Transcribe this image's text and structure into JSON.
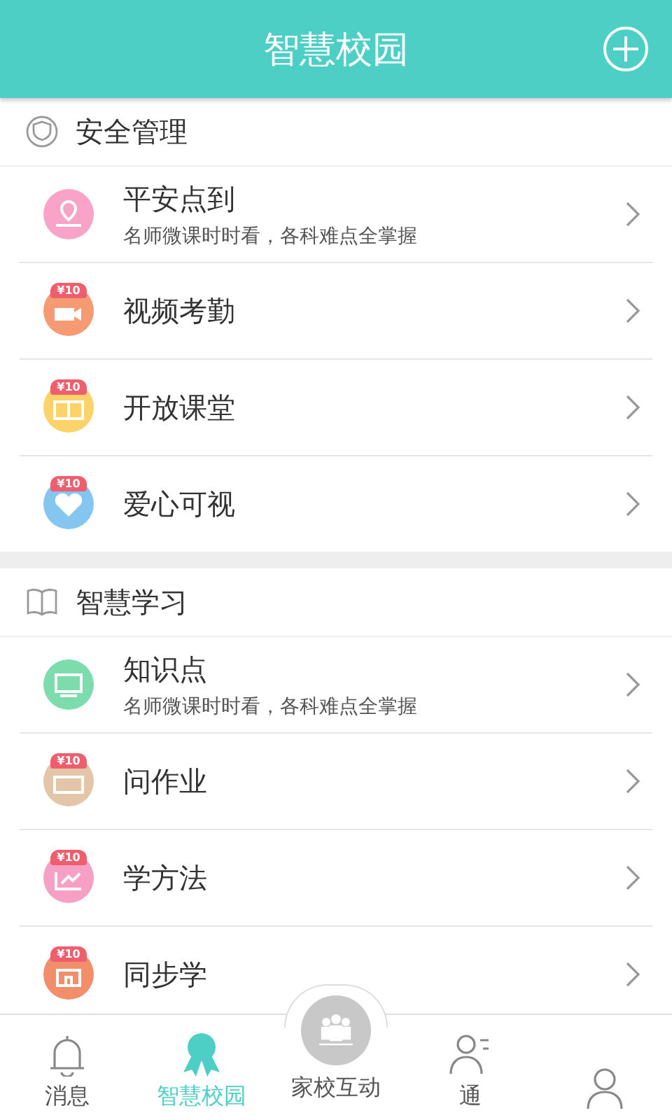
{
  "header": {
    "title": "智慧校园"
  },
  "sections": [
    {
      "title": "安全管理",
      "items": [
        {
          "title": "平安点到",
          "subtitle": "名师微课时时看，各科难点全掌握",
          "color": "#f9a3c9"
        },
        {
          "title": "视频考勤",
          "badge": "¥10",
          "color": "#f59a72"
        },
        {
          "title": "开放课堂",
          "badge": "¥10",
          "color": "#fcd36a"
        },
        {
          "title": "爱心可视",
          "badge": "¥10",
          "color": "#85c6f0"
        }
      ]
    },
    {
      "title": "智慧学习",
      "items": [
        {
          "title": "知识点",
          "subtitle": "名师微课时时看，各科难点全掌握",
          "color": "#7ddcac"
        },
        {
          "title": "问作业",
          "badge": "¥10",
          "color": "#e2c6a7"
        },
        {
          "title": "学方法",
          "badge": "¥10",
          "color": "#f7a0c6"
        },
        {
          "title": "同步学",
          "badge": "¥10",
          "color": "#f28e6a"
        }
      ]
    }
  ],
  "tabs": [
    {
      "label": "消息",
      "selected": false,
      "kind": "bell"
    },
    {
      "label": "智慧校园",
      "selected": true,
      "kind": "ribbon"
    },
    {
      "label": "家校互动",
      "selected": false,
      "kind": "center"
    },
    {
      "label": "通",
      "selected": false,
      "kind": "contacts"
    },
    {
      "selected": false,
      "kind": "person"
    }
  ]
}
